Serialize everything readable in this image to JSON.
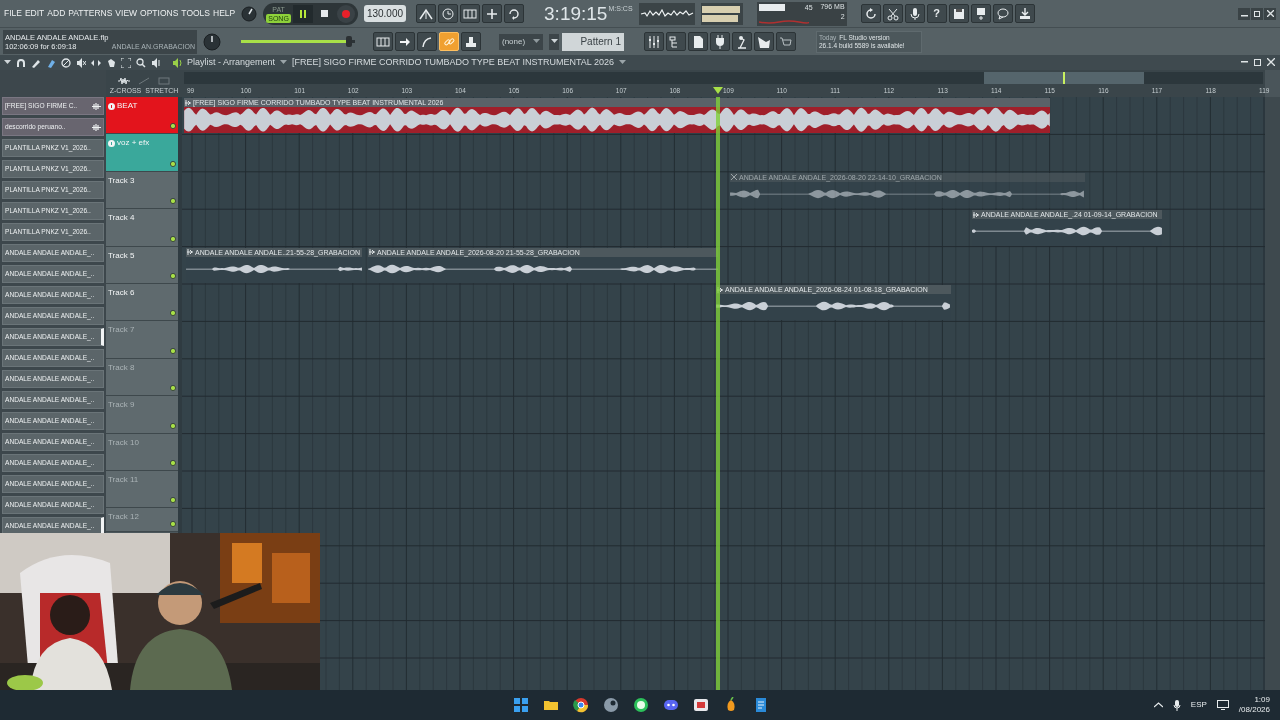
{
  "menu": [
    "FILE",
    "EDIT",
    "ADD",
    "PATTERNS",
    "VIEW",
    "OPTIONS",
    "TOOLS",
    "HELP"
  ],
  "modes": [
    {
      "label": "PAT",
      "selected": false
    },
    {
      "label": "SONG",
      "selected": true
    }
  ],
  "transport": {
    "playing": true,
    "tempo": "130.000"
  },
  "clock": {
    "time": "3:19:15",
    "unit": "M:S:CS"
  },
  "resources": {
    "cpu": "45",
    "memory": "796 MB",
    "polyphony": "2"
  },
  "project": {
    "file": "ANDALE ANDALE ANDALE.flp",
    "position": "102:06:09 for 6:09:18",
    "hint": "ANDALE AN.GRABACION"
  },
  "master_volume": {
    "level": 0.95
  },
  "link_toggle": {
    "on": true
  },
  "pattern": {
    "group": "(none)",
    "name": "Pattern 1"
  },
  "help_button": "?",
  "news": {
    "when": "Today",
    "title": "FL Studio version",
    "message": "26.1.4 build 5589 is available!"
  },
  "playlist": {
    "title": "Playlist - Arrangement",
    "song": "[FREE] SIGO FIRME CORRIDO TUMBADO TYPE BEAT INSTRUMENTAL 2026",
    "crossfade": "Z-CROSS",
    "stretch": "STRETCH"
  },
  "ruler": [
    "99",
    "100",
    "101",
    "102",
    "103",
    "104",
    "105",
    "106",
    "107",
    "108",
    "109",
    "110",
    "111",
    "112",
    "113",
    "114",
    "115",
    "116",
    "117",
    "118",
    "119"
  ],
  "browser": [
    {
      "label": "[FREE] SIGO FIRME C..",
      "kind": "audio",
      "selected": false
    },
    {
      "label": "descorrido peruano..",
      "kind": "audio",
      "selected": false
    },
    {
      "label": "PLANTILLA PNKZ V1_2026..",
      "kind": "pattern",
      "selected": false
    },
    {
      "label": "PLANTILLA PNKZ V1_2026..",
      "kind": "pattern",
      "selected": false
    },
    {
      "label": "PLANTILLA PNKZ V1_2026..",
      "kind": "pattern",
      "selected": false
    },
    {
      "label": "PLANTILLA PNKZ V1_2026..",
      "kind": "pattern",
      "selected": false
    },
    {
      "label": "PLANTILLA PNKZ V1_2026..",
      "kind": "pattern",
      "selected": false
    },
    {
      "label": "ANDALE ANDALE ANDALE_..",
      "kind": "pattern",
      "selected": false
    },
    {
      "label": "ANDALE ANDALE ANDALE_..",
      "kind": "pattern",
      "selected": false
    },
    {
      "label": "ANDALE ANDALE ANDALE_..",
      "kind": "pattern",
      "selected": false
    },
    {
      "label": "ANDALE ANDALE ANDALE_..",
      "kind": "pattern",
      "selected": false
    },
    {
      "label": "ANDALE ANDALE ANDALE_..",
      "kind": "pattern",
      "selected": true
    },
    {
      "label": "ANDALE ANDALE ANDALE_..",
      "kind": "pattern",
      "selected": false
    },
    {
      "label": "ANDALE ANDALE ANDALE_..",
      "kind": "pattern",
      "selected": false
    },
    {
      "label": "ANDALE ANDALE ANDALE_..",
      "kind": "pattern",
      "selected": false
    },
    {
      "label": "ANDALE ANDALE ANDALE_..",
      "kind": "pattern",
      "selected": false
    },
    {
      "label": "ANDALE ANDALE ANDALE_..",
      "kind": "pattern",
      "selected": false
    },
    {
      "label": "ANDALE ANDALE ANDALE_..",
      "kind": "pattern",
      "selected": false
    },
    {
      "label": "ANDALE ANDALE ANDALE_..",
      "kind": "pattern",
      "selected": false
    },
    {
      "label": "ANDALE ANDALE ANDALE_..",
      "kind": "pattern",
      "selected": false
    },
    {
      "label": "ANDALE ANDALE ANDALE_..",
      "kind": "pattern",
      "selected": true
    }
  ],
  "tracks": [
    {
      "name": "BEAT",
      "color": "#e3141c",
      "empty": false
    },
    {
      "name": "voz + efx",
      "color": "#3aa89b",
      "empty": false
    },
    {
      "name": "Track 3",
      "color": "#5f6a6e",
      "empty": false
    },
    {
      "name": "Track 4",
      "color": "#5f6a6e",
      "empty": false
    },
    {
      "name": "Track 5",
      "color": "#5f6a6e",
      "empty": false
    },
    {
      "name": "Track 6",
      "color": "#5f6a6e",
      "empty": false
    },
    {
      "name": "Track 7",
      "color": "#5f6a6e",
      "empty": true
    },
    {
      "name": "Track 8",
      "color": "#5f6a6e",
      "empty": true
    },
    {
      "name": "Track 9",
      "color": "#5f6a6e",
      "empty": true
    },
    {
      "name": "Track 10",
      "color": "#5f6a6e",
      "empty": true
    },
    {
      "name": "Track 11",
      "color": "#5f6a6e",
      "empty": true
    },
    {
      "name": "Track 12",
      "color": "#5f6a6e",
      "empty": true
    }
  ],
  "clips": [
    {
      "label": "[FREE] SIGO FIRME CORRIDO TUMBADO TYPE BEAT INSTRUMENTAL 2026",
      "kind": "beat",
      "muted": false
    },
    {
      "label": "ANDALE ANDALE ANDALE_2026-08-20 22-14-10_GRABACION",
      "kind": "vocal",
      "muted": true
    },
    {
      "label": "ANDALE ANDALE ANDALE_.24 01-09-14_GRABACION",
      "kind": "vocal",
      "muted": false
    },
    {
      "label": "ANDALE ANDALE ANDALE..21-55-28_GRABACION",
      "kind": "vocal",
      "muted": false
    },
    {
      "label": "ANDALE ANDALE ANDALE_2026-08-20 21-55-28_GRABACION",
      "kind": "vocal",
      "muted": false
    },
    {
      "label": "ANDALE ANDALE ANDALE_2026-08-24 01-08-18_GRABACION",
      "kind": "vocal",
      "muted": false
    }
  ],
  "taskbar": {
    "language": "ESP",
    "time": "1:09",
    "date": "/08/2026"
  }
}
